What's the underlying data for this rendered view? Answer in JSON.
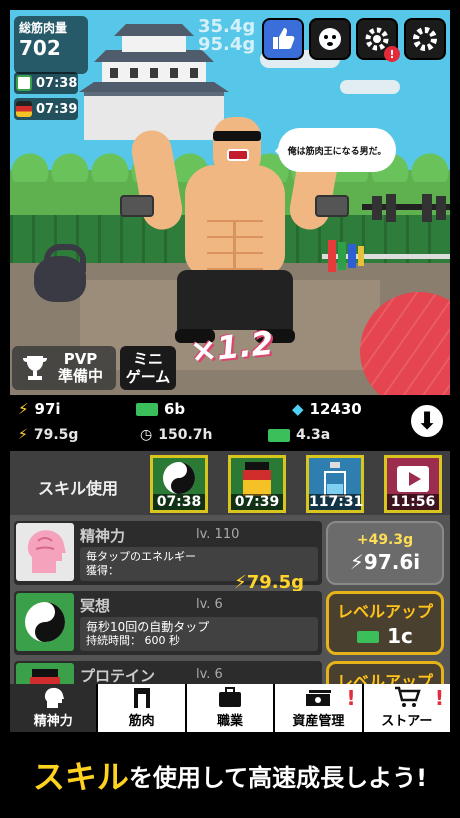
{
  "hud": {
    "total_label": "総筋肉量",
    "total_value": "702",
    "floating_1": "35.4g",
    "floating_2": "95.4g",
    "timer_1": "07:38",
    "timer_2": "07:39"
  },
  "speech": "俺は筋肉王になる男だ。",
  "multiplier": "×1.2",
  "top_buttons": [
    "like-icon",
    "face-icon",
    "gear-alert-icon",
    "gear-icon"
  ],
  "side_buttons": {
    "pvp_line1": "PVP",
    "pvp_line2": "準備中",
    "mini_line1": "ミニ",
    "mini_line2": "ゲーム"
  },
  "stats": {
    "power": "97i",
    "cash": "6b",
    "gems": "12430",
    "tap": "79.5g",
    "time": "150.7h",
    "cash_time": "4.3a"
  },
  "skills": {
    "label": "スキル使用",
    "slots": [
      "07:38",
      "07:39",
      "117:31",
      "11:56"
    ]
  },
  "cards": [
    {
      "name": "精神力",
      "level": "lv. 110",
      "desc1": "毎タップのエネルギー",
      "desc2": "獲得：",
      "value": "79.5g",
      "btn_top": "+49.3g",
      "btn_bottom": "97.6i"
    },
    {
      "name": "冥想",
      "level": "lv. 6",
      "desc1": "毎秒10回の自動タップ",
      "desc2": "持続時間： 600 秒",
      "btn_top": "レベルアップ",
      "btn_bottom": "1c"
    },
    {
      "name": "プロテイン",
      "level": "lv. 6",
      "btn_top": "レベルアップ"
    }
  ],
  "nav": [
    "精神力",
    "筋肉",
    "職業",
    "資産管理",
    "ストアー"
  ],
  "banner": {
    "highlight": "スキル",
    "rest": "を使用して高速成長しよう!"
  },
  "colors": {
    "accent_gold": "#ffd42b",
    "alert_red": "#e32b3b",
    "sky": "#56c7e9"
  }
}
